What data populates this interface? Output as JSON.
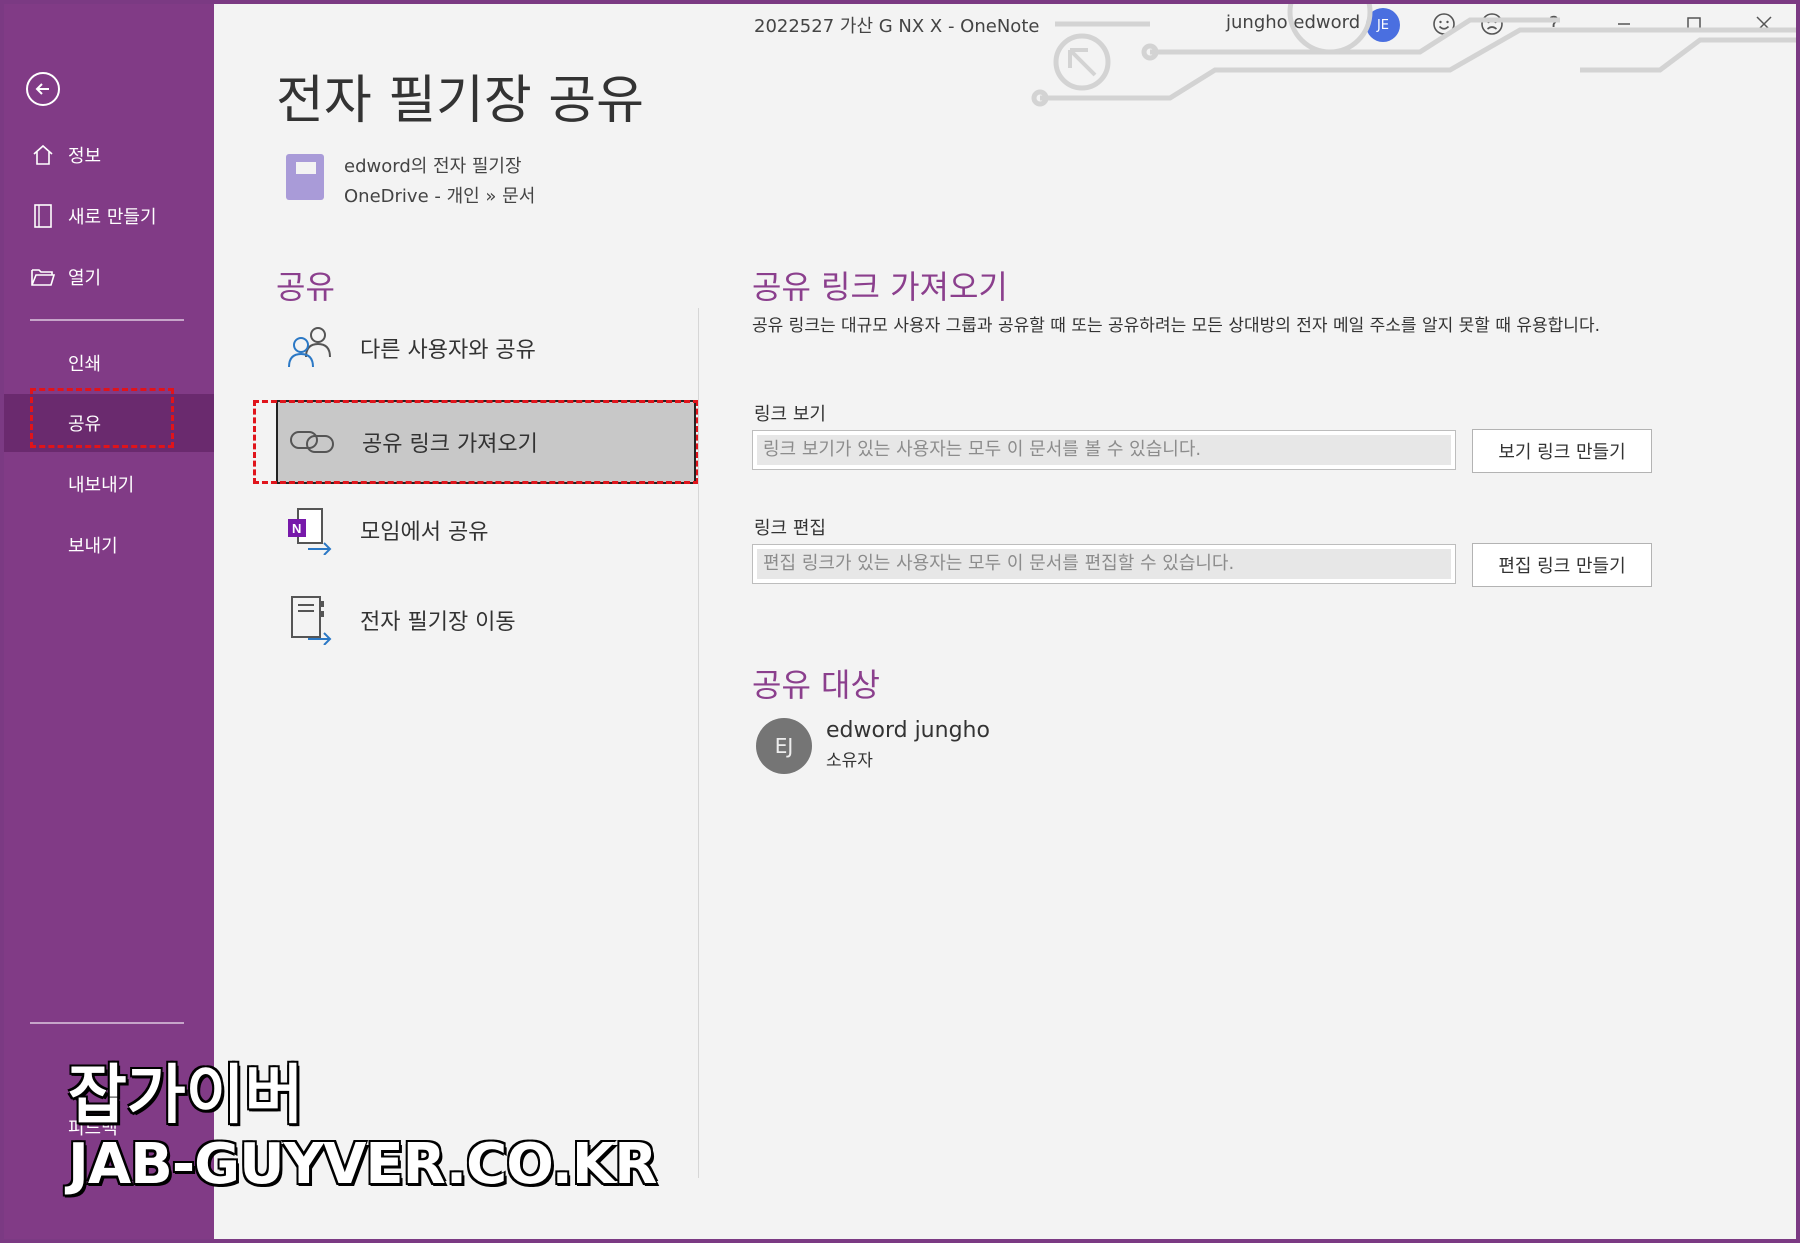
{
  "titlebar": {
    "doc_title": "2022527 가산 G NX X  -  OneNote",
    "user_name": "jungho edword",
    "user_initials": "JE"
  },
  "sidebar": {
    "items": [
      {
        "label": "정보"
      },
      {
        "label": "새로 만들기"
      },
      {
        "label": "열기"
      },
      {
        "label": "인쇄"
      },
      {
        "label": "공유"
      },
      {
        "label": "내보내기"
      },
      {
        "label": "보내기"
      }
    ],
    "active": "공유",
    "bottom_partial": "피드백"
  },
  "main": {
    "page_title": "전자 필기장 공유",
    "notebook_name": "edword의 전자 필기장",
    "notebook_path": "OneDrive - 개인 » 문서",
    "share_heading": "공유",
    "options": [
      {
        "label": "다른 사용자와 공유",
        "icon": "people-icon"
      },
      {
        "label": "공유 링크 가져오기",
        "icon": "link-icon"
      },
      {
        "label": "모임에서 공유",
        "icon": "onenote-meeting-icon"
      },
      {
        "label": "전자 필기장 이동",
        "icon": "move-notebook-icon"
      }
    ],
    "selected_option": "공유 링크 가져오기"
  },
  "share_link": {
    "heading": "공유 링크 가져오기",
    "description": "공유 링크는 대규모 사용자 그룹과 공유할 때 또는 공유하려는 모든 상대방의 전자 메일 주소를 알지 못할 때 유용합니다.",
    "view_label": "링크 보기",
    "view_placeholder": "링크 보기가 있는 사용자는 모두 이 문서를 볼 수 있습니다.",
    "view_button": "보기 링크 만들기",
    "edit_label": "링크 편집",
    "edit_placeholder": "편집 링크가 있는 사용자는 모두 이 문서를 편집할 수 있습니다.",
    "edit_button": "편집 링크 만들기"
  },
  "shared_with": {
    "heading": "공유 대상",
    "initials": "EJ",
    "name": "edword jungho",
    "role": "소유자"
  },
  "watermark": {
    "line1": "잡가이버",
    "line2": "JAB-GUYVER.CO.KR"
  },
  "colors": {
    "sidebar": "#813b86",
    "accent": "#8b3f8d",
    "highlight": "#e0141b"
  }
}
